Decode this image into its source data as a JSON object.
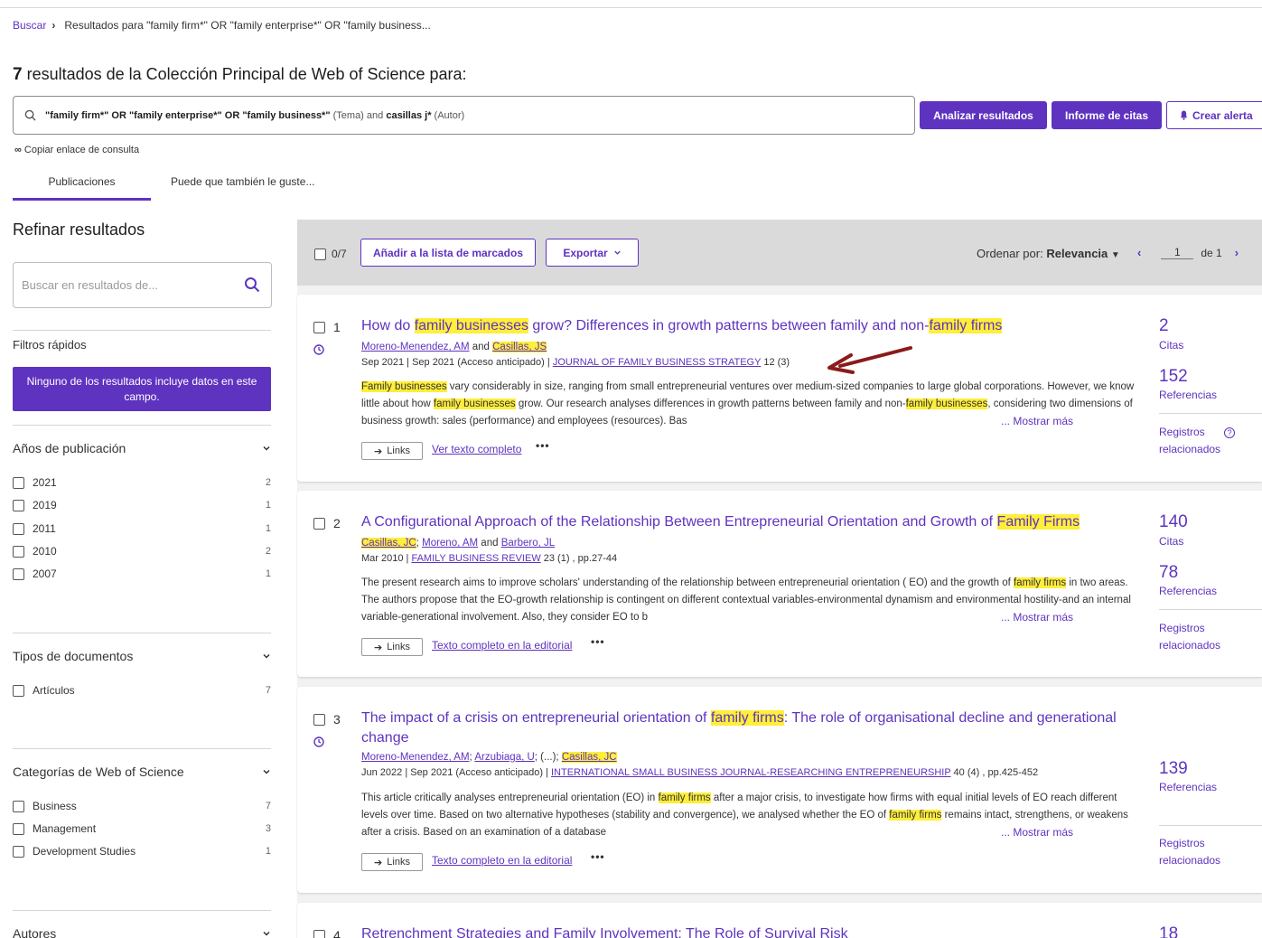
{
  "breadcrumb": {
    "search": "Buscar",
    "current": "Resultados para \"family firm*\" OR \"family enterprise*\" OR \"family business..."
  },
  "heading": {
    "count": "7",
    "text": "resultados de la Colección Principal de Web of Science para:"
  },
  "query": {
    "part1": "\"family firm*\" OR \"family enterprise*\" OR \"family business*\"",
    "part2": "(Tema) and",
    "part3": "casillas j*",
    "part4": "(Autor)"
  },
  "actions": {
    "analyze": "Analizar resultados",
    "citations": "Informe de citas",
    "alert": "Crear alerta"
  },
  "copy_link": "Copiar enlace de consulta",
  "tabs": [
    "Publicaciones",
    "Puede que también le guste..."
  ],
  "sidebar": {
    "title": "Refinar resultados",
    "search_placeholder": "Buscar en resultados de...",
    "quick_filters": "Filtros rápidos",
    "quick_button": "Ninguno de los resultados incluye datos en este campo.",
    "years": {
      "title": "Años de publicación",
      "items": [
        {
          "label": "2021",
          "count": "2"
        },
        {
          "label": "2019",
          "count": "1"
        },
        {
          "label": "2011",
          "count": "1"
        },
        {
          "label": "2010",
          "count": "2"
        },
        {
          "label": "2007",
          "count": "1"
        }
      ]
    },
    "doctypes": {
      "title": "Tipos de documentos",
      "items": [
        {
          "label": "Artículos",
          "count": "7"
        }
      ]
    },
    "categories": {
      "title": "Categorías de Web of Science",
      "items": [
        {
          "label": "Business",
          "count": "7"
        },
        {
          "label": "Management",
          "count": "3"
        },
        {
          "label": "Development Studies",
          "count": "1"
        }
      ]
    },
    "authors_title": "Autores"
  },
  "toolbar": {
    "selected": "0/7",
    "add_marked": "Añadir a la lista de marcados",
    "export": "Exportar",
    "sort_label": "Ordenar por:",
    "sort_value": "Relevancia",
    "page": "1",
    "page_of": "de 1"
  },
  "results": [
    {
      "num": "1",
      "title": [
        "How do ",
        "family businesses",
        " grow? Differences in growth patterns between family and non-",
        "family firms"
      ],
      "authors": [
        "Moreno-Menendez, AM",
        " and ",
        "Casillas, JS"
      ],
      "meta_pre": "Sep 2021 | Sep 2021 (Acceso anticipado) | ",
      "journal": "JOURNAL OF FAMILY BUSINESS STRATEGY",
      "meta_post": " 12 (3)",
      "abstract": [
        "Family businesses",
        " vary considerably in size, ranging from small entrepreneurial ventures over medium-sized companies to large global corporations. However, we know little about how ",
        "family businesses",
        " grow. Our research analyses differences in growth patterns between family and non-",
        "family businesses",
        ", considering two dimensions of business growth: sales (performance) and employees (resources). Bas"
      ],
      "more": "... Mostrar más",
      "links": "Links",
      "fulltext": "Ver texto completo",
      "stat1_num": "2",
      "stat1_lbl": "Citas",
      "stat2_num": "152",
      "stat2_lbl": "Referencias",
      "related1": "Registros",
      "related2": "relacionados"
    },
    {
      "num": "2",
      "title": [
        "A Configurational Approach of the Relationship Between Entrepreneurial Orientation and Growth of ",
        "Family Firms"
      ],
      "authors": [
        "Casillas, JC",
        "; ",
        "Moreno, AM",
        " and ",
        "Barbero, JL"
      ],
      "meta_pre": "Mar 2010 | ",
      "journal": "FAMILY BUSINESS REVIEW",
      "meta_post": " 23 (1) , pp.27-44",
      "abstract": [
        "The present research aims to improve scholars' understanding of the relationship between entrepreneurial orientation ( EO) and the growth of ",
        "family firms",
        " in two areas. The authors propose that the EO-growth relationship is contingent on different contextual variables-environmental dynamism and environmental hostility-and an internal variable-generational involvement. Also, they consider EO to b"
      ],
      "more": "... Mostrar más",
      "links": "Links",
      "fulltext": "Texto completo en la editorial",
      "stat1_num": "140",
      "stat1_lbl": "Citas",
      "stat2_num": "78",
      "stat2_lbl": "Referencias",
      "related1": "Registros",
      "related2": "relacionados"
    },
    {
      "num": "3",
      "title": [
        "The impact of a crisis on entrepreneurial orientation of ",
        "family firms",
        ": The role of organisational decline and generational change"
      ],
      "authors": [
        "Moreno-Menendez, AM",
        "; ",
        "Arzubiaga, U",
        "; (...); ",
        "Casillas, JC"
      ],
      "meta_pre": "Jun 2022 | Sep 2021 (Acceso anticipado) | ",
      "journal": "INTERNATIONAL SMALL BUSINESS JOURNAL-RESEARCHING ENTREPRENEURSHIP",
      "meta_post": " 40 (4) , pp.425-452",
      "abstract": [
        "This article critically analyses entrepreneurial orientation (EO) in ",
        "family firms",
        " after a major crisis, to investigate how firms with equal initial levels of EO reach different levels over time. Based on two alternative hypotheses (stability and convergence), we analysed whether the EO of ",
        "family firms",
        " remains intact, strengthens, or weakens after a crisis. Based on an examination of a database"
      ],
      "more": "... Mostrar más",
      "links": "Links",
      "fulltext": "Texto completo en la editorial",
      "stat1_num": "139",
      "stat1_lbl": "Referencias",
      "related1": "Registros",
      "related2": "relacionados"
    },
    {
      "num": "4",
      "title": "Retrenchment Strategies and Family Involvement: The Role of Survival Risk",
      "stat1_num": "18"
    }
  ],
  "colors": {
    "accent": "#5e33bf",
    "highlight": "#ffee3a",
    "arrow": "#8b1a1a"
  }
}
